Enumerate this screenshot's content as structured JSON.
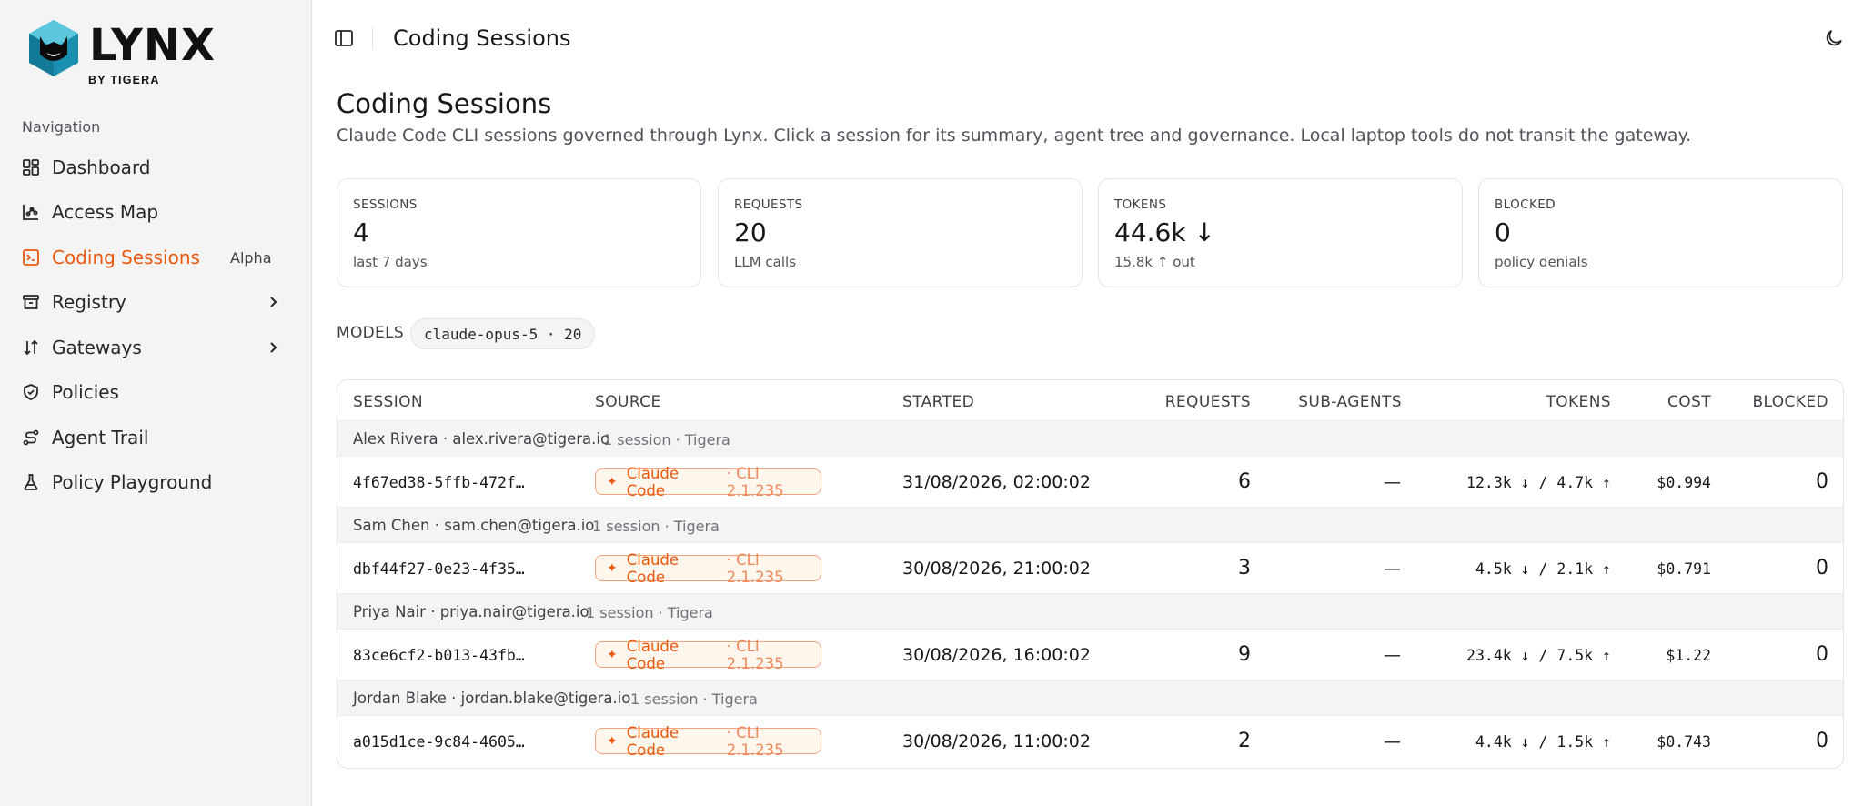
{
  "brand": {
    "name": "LYNX",
    "byline": "BY TIGERA"
  },
  "sidebar": {
    "heading": "Navigation",
    "items": [
      {
        "label": "Dashboard",
        "icon": "dashboard-icon"
      },
      {
        "label": "Access Map",
        "icon": "chart-icon"
      },
      {
        "label": "Coding Sessions",
        "icon": "terminal-icon",
        "active": true,
        "badge": "Alpha"
      },
      {
        "label": "Registry",
        "icon": "archive-icon",
        "chevron": true
      },
      {
        "label": "Gateways",
        "icon": "arrows-up-down-icon",
        "chevron": true
      },
      {
        "label": "Policies",
        "icon": "shield-check-icon"
      },
      {
        "label": "Agent Trail",
        "icon": "route-icon"
      },
      {
        "label": "Policy Playground",
        "icon": "flask-icon"
      }
    ]
  },
  "header": {
    "title": "Coding Sessions"
  },
  "main": {
    "title": "Coding Sessions",
    "subtitle": "Claude Code CLI sessions governed through Lynx. Click a session for its summary, agent tree and governance. Local laptop tools do not transit the gateway."
  },
  "stats": [
    {
      "label": "SESSIONS",
      "value": "4",
      "sub": "last 7 days"
    },
    {
      "label": "REQUESTS",
      "value": "20",
      "sub": "LLM calls"
    },
    {
      "label": "TOKENS",
      "value": "44.6k ↓",
      "sub": "15.8k ↑ out"
    },
    {
      "label": "BLOCKED",
      "value": "0",
      "sub": "policy denials"
    }
  ],
  "models": {
    "label": "MODELS",
    "chip": "claude-opus-5 · 20"
  },
  "table": {
    "columns": [
      "SESSION",
      "SOURCE",
      "STARTED",
      "REQUESTS",
      "SUB-AGENTS",
      "TOKENS",
      "COST",
      "BLOCKED"
    ],
    "groups": [
      {
        "user": "Alex Rivera · alex.rivera@tigera.io",
        "meta": "1 session · Tigera",
        "session": {
          "id": "4f67ed38-5ffb-472f…",
          "source": "Claude Code",
          "version": "· CLI 2.1.235",
          "started": "31/08/2026, 02:00:02",
          "requests": "6",
          "subagents": "—",
          "tokens": "12.3k ↓ / 4.7k ↑",
          "cost": "$0.994",
          "blocked": "0"
        }
      },
      {
        "user": "Sam Chen · sam.chen@tigera.io",
        "meta": "1 session · Tigera",
        "session": {
          "id": "dbf44f27-0e23-4f35…",
          "source": "Claude Code",
          "version": "· CLI 2.1.235",
          "started": "30/08/2026, 21:00:02",
          "requests": "3",
          "subagents": "—",
          "tokens": "4.5k ↓ / 2.1k ↑",
          "cost": "$0.791",
          "blocked": "0"
        }
      },
      {
        "user": "Priya Nair · priya.nair@tigera.io",
        "meta": "1 session · Tigera",
        "session": {
          "id": "83ce6cf2-b013-43fb…",
          "source": "Claude Code",
          "version": "· CLI 2.1.235",
          "started": "30/08/2026, 16:00:02",
          "requests": "9",
          "subagents": "—",
          "tokens": "23.4k ↓ / 7.5k ↑",
          "cost": "$1.22",
          "blocked": "0"
        }
      },
      {
        "user": "Jordan Blake · jordan.blake@tigera.io",
        "meta": "1 session · Tigera",
        "session": {
          "id": "a015d1ce-9c84-4605…",
          "source": "Claude Code",
          "version": "· CLI 2.1.235",
          "started": "30/08/2026, 11:00:02",
          "requests": "2",
          "subagents": "—",
          "tokens": "4.4k ↓ / 1.5k ↑",
          "cost": "$0.743",
          "blocked": "0"
        }
      }
    ]
  },
  "colors": {
    "accent": "#ea580c",
    "sidebar_bg": "#f4f4f5",
    "border": "#e4e4e7"
  }
}
